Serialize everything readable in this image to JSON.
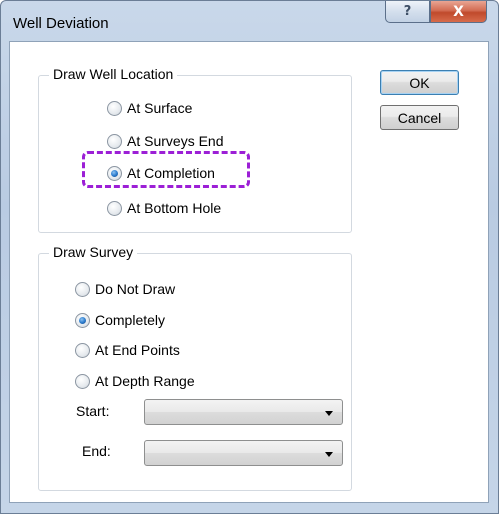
{
  "window": {
    "title": "Well Deviation",
    "help_glyph": "?",
    "close_glyph": "X"
  },
  "draw_well_location": {
    "title": "Draw Well Location",
    "options": [
      "At Surface",
      "At Surveys End",
      "At Completion",
      "At Bottom Hole"
    ],
    "selected": "At Completion"
  },
  "draw_survey": {
    "title": "Draw Survey",
    "options": [
      "Do Not Draw",
      "Completely",
      "At End Points",
      "At Depth Range"
    ],
    "selected": "Completely",
    "start_label": "Start:",
    "start_value": "",
    "end_label": "End:",
    "end_value": ""
  },
  "buttons": {
    "ok": "OK",
    "cancel": "Cancel"
  },
  "colors": {
    "highlight": "#9c1fd6",
    "radio_selected": "#2f7fd0"
  }
}
